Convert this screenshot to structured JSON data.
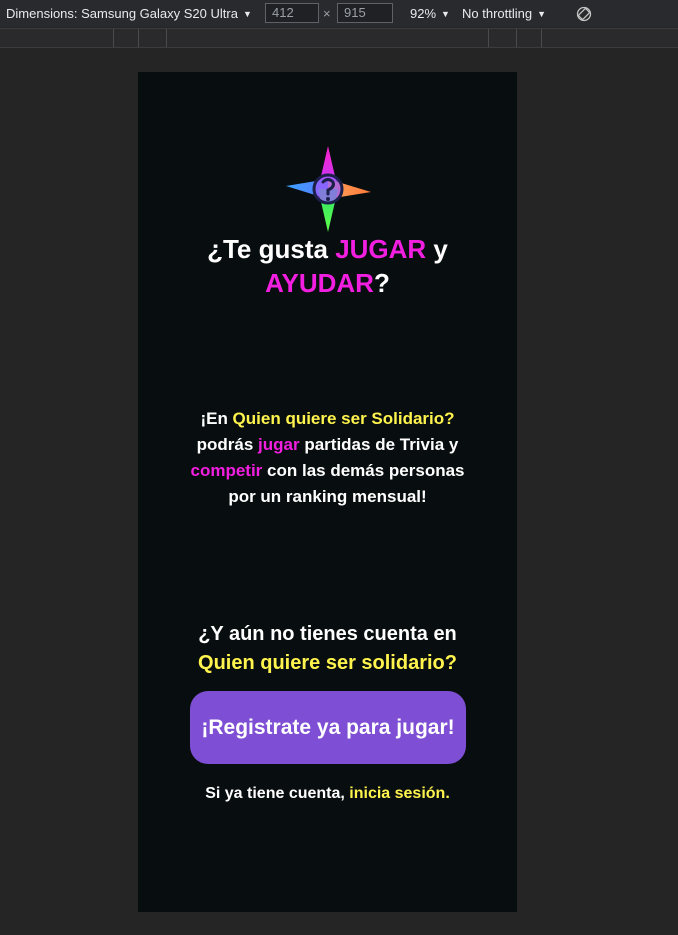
{
  "devtools": {
    "dimensions_label": "Dimensions: Samsung Galaxy S20 Ultra",
    "width": "412",
    "times": "×",
    "height": "915",
    "zoom": "92%",
    "throttling": "No throttling",
    "rotate_icon": "rotate-icon"
  },
  "page": {
    "headline": {
      "part1": "¿Te gusta ",
      "jugar": "JUGAR",
      "part2": " y",
      "ayudar": "AYUDAR",
      "part3": "?"
    },
    "intro": {
      "t1": "¡En ",
      "brand": "Quien quiere ser Solidario?",
      "t2": "podrás ",
      "jugar": "jugar",
      "t3": " partidas de Trivia y",
      "competir": "competir",
      "t4": " con las demás personas",
      "t5": "por un ranking mensual!"
    },
    "question": {
      "line1": "¿Y aún no tienes cuenta en",
      "brand": "Quien quiere ser solidario?"
    },
    "register_button": "¡Registrate ya para jugar!",
    "login": {
      "prefix": "Si ya tiene cuenta, ",
      "link": "inicia sesión."
    }
  },
  "colors": {
    "accent_pink": "#f21ee0",
    "accent_yellow": "#fff34d",
    "button_purple": "#7e4fd4",
    "page_background": "#080d0f"
  }
}
